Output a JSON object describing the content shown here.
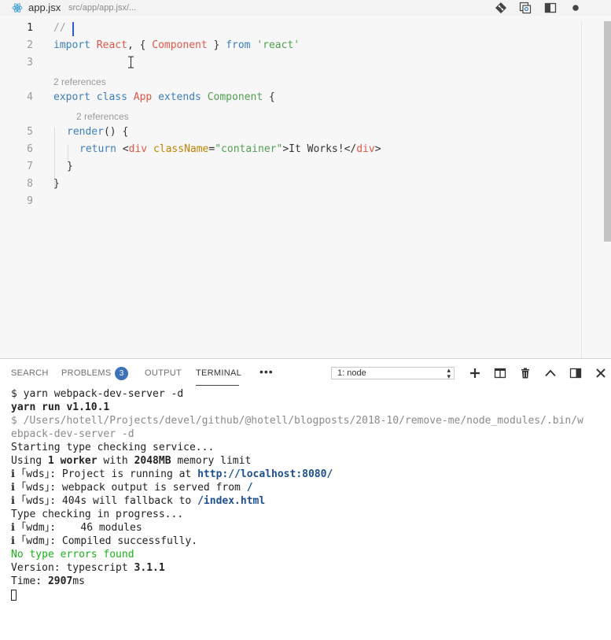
{
  "tab": {
    "icon": "react-icon",
    "title": "app.jsx",
    "path": "src/app/app.jsx/..."
  },
  "toolbar": {
    "icons": [
      "git-compare-icon",
      "open-preview-icon",
      "split-editor-icon",
      "unsaved-dot-icon"
    ]
  },
  "editor": {
    "line_numbers": [
      "1",
      "2",
      "3",
      "4",
      "5",
      "6",
      "7",
      "8",
      "9"
    ],
    "active_line": "1",
    "codelens_1": "2 references",
    "codelens_2": "2 references",
    "lines": {
      "l1": {
        "comment": "//"
      },
      "l2": {
        "kw_import": "import",
        "react": "React",
        "p1": ", { ",
        "component": "Component",
        "p2": " } ",
        "kw_from": "from",
        "sp": " ",
        "mod": "'react'"
      },
      "l4": {
        "kw_export": "export",
        "kw_class": "class",
        "app": "App",
        "kw_extends": "extends",
        "base": "Component",
        "brace": " {"
      },
      "l5": {
        "fn": "render",
        "rest": "() {"
      },
      "l6": {
        "kw_return": "return",
        "lt": " <",
        "tag": "div",
        "sp": " ",
        "attr": "className",
        "eq": "=",
        "val": "\"container\"",
        "text": ">It Works!</",
        "tag_close": "div",
        "gt": ">"
      },
      "l7": {
        "brace": "}"
      },
      "l8": {
        "brace": "}"
      }
    }
  },
  "panel": {
    "tabs": [
      {
        "label": "SEARCH"
      },
      {
        "label": "PROBLEMS"
      },
      {
        "label": "OUTPUT"
      },
      {
        "label": "TERMINAL"
      }
    ],
    "active_tab": "TERMINAL",
    "problems_count": "3",
    "more_label": "•••",
    "terminal_select": "1: node",
    "icons": [
      "add-terminal-icon",
      "split-terminal-icon",
      "trash-icon",
      "maximize-panel-icon",
      "toggle-panel-icon",
      "close-panel-icon"
    ]
  },
  "terminal": {
    "l1": "$ yarn webpack-dev-server -d",
    "l2": "yarn run v1.10.1",
    "l3": "$ /Users/hotell/Projects/devel/github/@hotell/blogposts/2018-10/remove-me/node_modules/.bin/w",
    "l4": "ebpack-dev-server -d",
    "l5": "Starting type checking service...",
    "l6": {
      "a": "Using ",
      "b": "1 worker",
      "c": " with ",
      "d": "2048MB",
      "e": " memory limit"
    },
    "l7": {
      "a": "ℹ ｢wds｣: Project is running at ",
      "b": "http://localhost:8080/"
    },
    "l8": {
      "a": "ℹ ｢wds｣: webpack output is served from ",
      "b": "/"
    },
    "l9": {
      "a": "ℹ ｢wds｣: 404s will fallback to ",
      "b": "/index.html"
    },
    "l10": "Type checking in progress...",
    "l11": "ℹ ｢wdm｣:    46 modules",
    "l12": "ℹ ｢wdm｣: Compiled successfully.",
    "l13": "No type errors found",
    "l14": {
      "a": "Version: typescript ",
      "b": "3.1.1"
    },
    "l15": {
      "a": "Time: ",
      "b": "2907",
      "c": "ms"
    }
  },
  "colors": {
    "accent": "#3c73b8",
    "success": "#18b318",
    "link": "#1d4f91"
  }
}
